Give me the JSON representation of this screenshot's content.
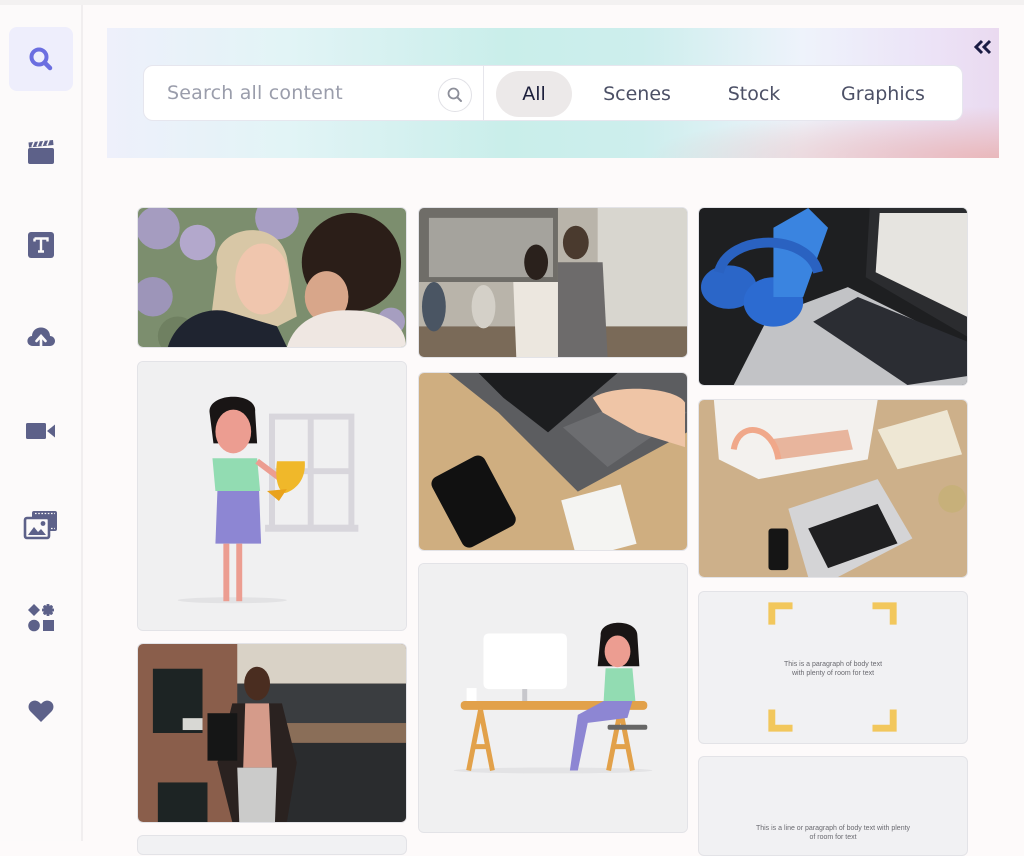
{
  "sidebar": {
    "items": [
      {
        "name": "search",
        "icon": "search-icon",
        "active": true
      },
      {
        "name": "scenes",
        "icon": "clapperboard-icon",
        "active": false
      },
      {
        "name": "text",
        "icon": "text-icon",
        "active": false
      },
      {
        "name": "upload",
        "icon": "cloud-upload-icon",
        "active": false
      },
      {
        "name": "video",
        "icon": "video-camera-icon",
        "active": false
      },
      {
        "name": "media",
        "icon": "media-library-icon",
        "active": false
      },
      {
        "name": "elements",
        "icon": "shapes-icon",
        "active": false
      },
      {
        "name": "favorites",
        "icon": "heart-icon",
        "active": false
      }
    ]
  },
  "header": {
    "collapse_icon": "double-chevron-left-icon",
    "search": {
      "placeholder": "Search all content",
      "value": "",
      "icon": "search-icon"
    },
    "tabs": [
      {
        "label": "All",
        "active": true
      },
      {
        "label": "Scenes",
        "active": false
      },
      {
        "label": "Stock",
        "active": false
      },
      {
        "label": "Graphics",
        "active": false
      }
    ]
  },
  "colors": {
    "accent": "#6b6ee0",
    "sidebar_icon": "#5d6189",
    "active_bg": "#eeeefc",
    "template_corner": "#f2c75c"
  },
  "results": {
    "columns": [
      [
        {
          "type": "stock-photo",
          "subject": "couple laughing in front of lilac bushes"
        },
        {
          "type": "graphic",
          "subject": "woman holding golden trophy near window"
        },
        {
          "type": "stock-photo",
          "subject": "woman walking in front of brick building"
        }
      ],
      [
        {
          "type": "stock-photo",
          "subject": "team meeting in office"
        },
        {
          "type": "stock-photo",
          "subject": "hand on laptop trackpad with phone and notepad"
        },
        {
          "type": "graphic",
          "subject": "woman sitting at desk with computer"
        }
      ],
      [
        {
          "type": "stock-photo",
          "subject": "blue headphones and phone next to laptop"
        },
        {
          "type": "stock-photo",
          "subject": "person with pink headphones at laptop"
        },
        {
          "type": "scene-template",
          "text": "This is a paragraph of body text with plenty of room for text",
          "lines": [
            "This is a paragraph of body text",
            "with plenty of room for text"
          ]
        },
        {
          "type": "scene-template",
          "text": "This is a line or paragraph of body text with plenty of room for text",
          "lines": [
            "This is a line or paragraph of body text with plenty",
            "of room for text"
          ]
        }
      ]
    ]
  }
}
